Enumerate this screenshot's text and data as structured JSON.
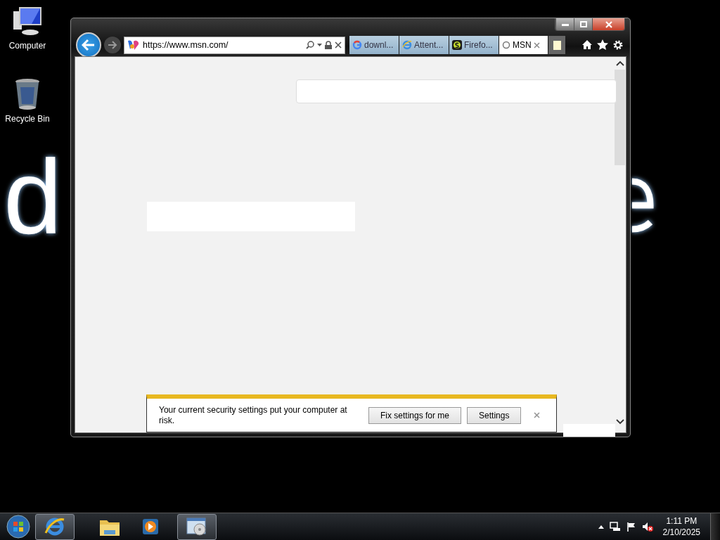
{
  "desktop": {
    "wallpaper_text": [
      "d"
    ],
    "icons": [
      {
        "kind": "computer",
        "label": "Computer"
      },
      {
        "kind": "recycle",
        "label": "Recycle Bin"
      }
    ]
  },
  "browser": {
    "address": "https://www.msn.com/",
    "tabs": [
      {
        "kind": "google",
        "label": "downl...",
        "selected": false
      },
      {
        "kind": "ie",
        "label": "Attent...",
        "selected": false
      },
      {
        "kind": "s",
        "label": "Firefo...",
        "selected": false
      },
      {
        "kind": "loading",
        "label": "MSN",
        "selected": true
      }
    ],
    "notification": {
      "message": "Your current security settings put your computer at risk.",
      "buttons": [
        "Fix settings for me",
        "Settings"
      ]
    }
  },
  "taskbar": {
    "items": [
      {
        "kind": "ie",
        "active": true
      },
      {
        "kind": "folder",
        "active": false
      },
      {
        "kind": "media",
        "active": false
      },
      {
        "kind": "app",
        "active": true
      }
    ],
    "clock": {
      "time": "1:11 PM",
      "date": "2/10/2025"
    }
  }
}
